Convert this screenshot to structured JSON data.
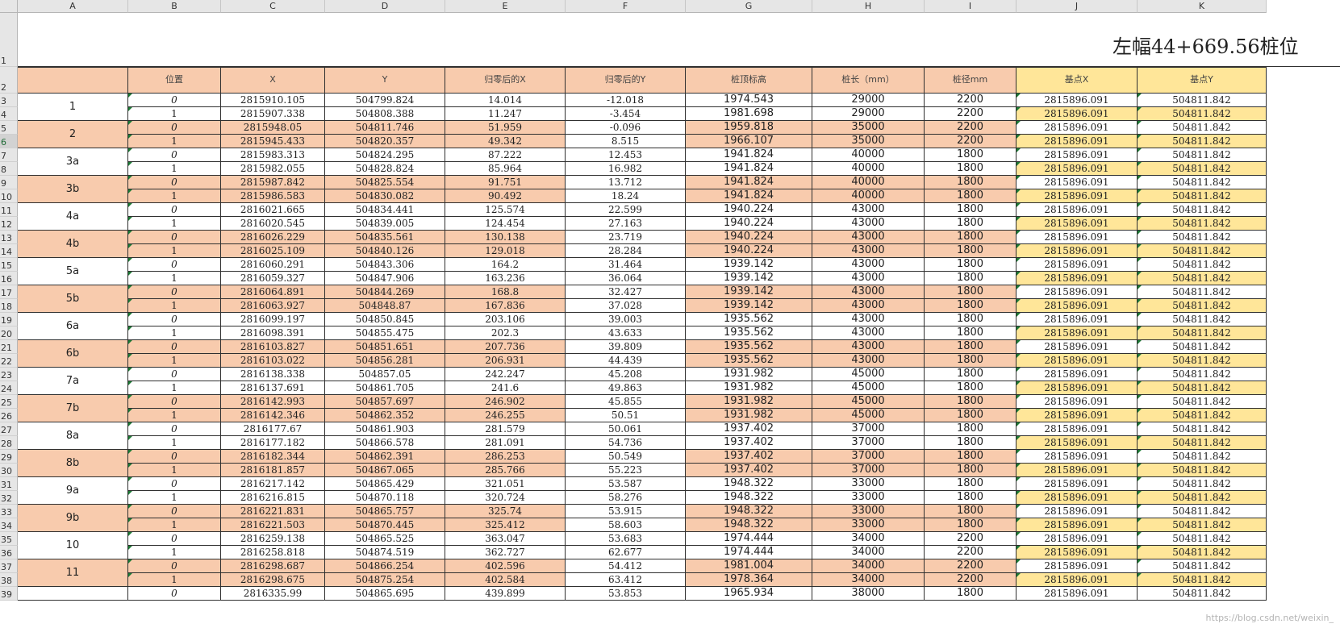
{
  "colors": {
    "orange": "#f8cbad",
    "yellow": "#ffe699",
    "white": "#ffffff",
    "header_gray": "#e6e6e6"
  },
  "columns": [
    "A",
    "B",
    "C",
    "D",
    "E",
    "F",
    "G",
    "H",
    "I",
    "J",
    "K"
  ],
  "title": "左幅44+669.56桩位",
  "headers": [
    "位置",
    "X",
    "Y",
    "归零后的X",
    "归零后的Y",
    "桩顶标高",
    "桩长（mm）",
    "桩径mm",
    "基点X",
    "基点Y"
  ],
  "groups": [
    {
      "label": "1",
      "rows": [
        [
          "0",
          "2815910.105",
          "504799.824",
          "14.014",
          "-12.018",
          "1974.543",
          "29000",
          "2200",
          "2815896.091",
          "504811.842"
        ],
        [
          "1",
          "2815907.338",
          "504808.388",
          "11.247",
          "-3.454",
          "1981.698",
          "29000",
          "2200",
          "2815896.091",
          "504811.842"
        ]
      ]
    },
    {
      "label": "2",
      "rows": [
        [
          "0",
          "2815948.05",
          "504811.746",
          "51.959",
          "-0.096",
          "1959.818",
          "35000",
          "2200",
          "2815896.091",
          "504811.842"
        ],
        [
          "1",
          "2815945.433",
          "504820.357",
          "49.342",
          "8.515",
          "1966.107",
          "35000",
          "2200",
          "2815896.091",
          "504811.842"
        ]
      ]
    },
    {
      "label": "3a",
      "rows": [
        [
          "0",
          "2815983.313",
          "504824.295",
          "87.222",
          "12.453",
          "1941.824",
          "40000",
          "1800",
          "2815896.091",
          "504811.842"
        ],
        [
          "1",
          "2815982.055",
          "504828.824",
          "85.964",
          "16.982",
          "1941.824",
          "40000",
          "1800",
          "2815896.091",
          "504811.842"
        ]
      ]
    },
    {
      "label": "3b",
      "rows": [
        [
          "0",
          "2815987.842",
          "504825.554",
          "91.751",
          "13.712",
          "1941.824",
          "40000",
          "1800",
          "2815896.091",
          "504811.842"
        ],
        [
          "1",
          "2815986.583",
          "504830.082",
          "90.492",
          "18.24",
          "1941.824",
          "40000",
          "1800",
          "2815896.091",
          "504811.842"
        ]
      ]
    },
    {
      "label": "4a",
      "rows": [
        [
          "0",
          "2816021.665",
          "504834.441",
          "125.574",
          "22.599",
          "1940.224",
          "43000",
          "1800",
          "2815896.091",
          "504811.842"
        ],
        [
          "1",
          "2816020.545",
          "504839.005",
          "124.454",
          "27.163",
          "1940.224",
          "43000",
          "1800",
          "2815896.091",
          "504811.842"
        ]
      ]
    },
    {
      "label": "4b",
      "rows": [
        [
          "0",
          "2816026.229",
          "504835.561",
          "130.138",
          "23.719",
          "1940.224",
          "43000",
          "1800",
          "2815896.091",
          "504811.842"
        ],
        [
          "1",
          "2816025.109",
          "504840.126",
          "129.018",
          "28.284",
          "1940.224",
          "43000",
          "1800",
          "2815896.091",
          "504811.842"
        ]
      ]
    },
    {
      "label": "5a",
      "rows": [
        [
          "0",
          "2816060.291",
          "504843.306",
          "164.2",
          "31.464",
          "1939.142",
          "43000",
          "1800",
          "2815896.091",
          "504811.842"
        ],
        [
          "1",
          "2816059.327",
          "504847.906",
          "163.236",
          "36.064",
          "1939.142",
          "43000",
          "1800",
          "2815896.091",
          "504811.842"
        ]
      ]
    },
    {
      "label": "5b",
      "rows": [
        [
          "0",
          "2816064.891",
          "504844.269",
          "168.8",
          "32.427",
          "1939.142",
          "43000",
          "1800",
          "2815896.091",
          "504811.842"
        ],
        [
          "1",
          "2816063.927",
          "504848.87",
          "167.836",
          "37.028",
          "1939.142",
          "43000",
          "1800",
          "2815896.091",
          "504811.842"
        ]
      ]
    },
    {
      "label": "6a",
      "rows": [
        [
          "0",
          "2816099.197",
          "504850.845",
          "203.106",
          "39.003",
          "1935.562",
          "43000",
          "1800",
          "2815896.091",
          "504811.842"
        ],
        [
          "1",
          "2816098.391",
          "504855.475",
          "202.3",
          "43.633",
          "1935.562",
          "43000",
          "1800",
          "2815896.091",
          "504811.842"
        ]
      ]
    },
    {
      "label": "6b",
      "rows": [
        [
          "0",
          "2816103.827",
          "504851.651",
          "207.736",
          "39.809",
          "1935.562",
          "43000",
          "1800",
          "2815896.091",
          "504811.842"
        ],
        [
          "1",
          "2816103.022",
          "504856.281",
          "206.931",
          "44.439",
          "1935.562",
          "43000",
          "1800",
          "2815896.091",
          "504811.842"
        ]
      ]
    },
    {
      "label": "7a",
      "rows": [
        [
          "0",
          "2816138.338",
          "504857.05",
          "242.247",
          "45.208",
          "1931.982",
          "45000",
          "1800",
          "2815896.091",
          "504811.842"
        ],
        [
          "1",
          "2816137.691",
          "504861.705",
          "241.6",
          "49.863",
          "1931.982",
          "45000",
          "1800",
          "2815896.091",
          "504811.842"
        ]
      ]
    },
    {
      "label": "7b",
      "rows": [
        [
          "0",
          "2816142.993",
          "504857.697",
          "246.902",
          "45.855",
          "1931.982",
          "45000",
          "1800",
          "2815896.091",
          "504811.842"
        ],
        [
          "1",
          "2816142.346",
          "504862.352",
          "246.255",
          "50.51",
          "1931.982",
          "45000",
          "1800",
          "2815896.091",
          "504811.842"
        ]
      ]
    },
    {
      "label": "8a",
      "rows": [
        [
          "0",
          "2816177.67",
          "504861.903",
          "281.579",
          "50.061",
          "1937.402",
          "37000",
          "1800",
          "2815896.091",
          "504811.842"
        ],
        [
          "1",
          "2816177.182",
          "504866.578",
          "281.091",
          "54.736",
          "1937.402",
          "37000",
          "1800",
          "2815896.091",
          "504811.842"
        ]
      ]
    },
    {
      "label": "8b",
      "rows": [
        [
          "0",
          "2816182.344",
          "504862.391",
          "286.253",
          "50.549",
          "1937.402",
          "37000",
          "1800",
          "2815896.091",
          "504811.842"
        ],
        [
          "1",
          "2816181.857",
          "504867.065",
          "285.766",
          "55.223",
          "1937.402",
          "37000",
          "1800",
          "2815896.091",
          "504811.842"
        ]
      ]
    },
    {
      "label": "9a",
      "rows": [
        [
          "0",
          "2816217.142",
          "504865.429",
          "321.051",
          "53.587",
          "1948.322",
          "33000",
          "1800",
          "2815896.091",
          "504811.842"
        ],
        [
          "1",
          "2816216.815",
          "504870.118",
          "320.724",
          "58.276",
          "1948.322",
          "33000",
          "1800",
          "2815896.091",
          "504811.842"
        ]
      ]
    },
    {
      "label": "9b",
      "rows": [
        [
          "0",
          "2816221.831",
          "504865.757",
          "325.74",
          "53.915",
          "1948.322",
          "33000",
          "1800",
          "2815896.091",
          "504811.842"
        ],
        [
          "1",
          "2816221.503",
          "504870.445",
          "325.412",
          "58.603",
          "1948.322",
          "33000",
          "1800",
          "2815896.091",
          "504811.842"
        ]
      ]
    },
    {
      "label": "10",
      "rows": [
        [
          "0",
          "2816259.138",
          "504865.525",
          "363.047",
          "53.683",
          "1974.444",
          "34000",
          "2200",
          "2815896.091",
          "504811.842"
        ],
        [
          "1",
          "2816258.818",
          "504874.519",
          "362.727",
          "62.677",
          "1974.444",
          "34000",
          "2200",
          "2815896.091",
          "504811.842"
        ]
      ]
    },
    {
      "label": "11",
      "rows": [
        [
          "0",
          "2816298.687",
          "504866.254",
          "402.596",
          "54.412",
          "1981.004",
          "34000",
          "2200",
          "2815896.091",
          "504811.842"
        ],
        [
          "1",
          "2816298.675",
          "504875.254",
          "402.584",
          "63.412",
          "1978.364",
          "34000",
          "2200",
          "2815896.091",
          "504811.842"
        ]
      ]
    }
  ],
  "partial_row": [
    "0",
    "2816335.99",
    "504865.695",
    "439.899",
    "53.853",
    "1965.934",
    "38000",
    "1800",
    "2815896.091",
    "504811.842"
  ],
  "watermark": "https://blog.csdn.net/weixin_"
}
